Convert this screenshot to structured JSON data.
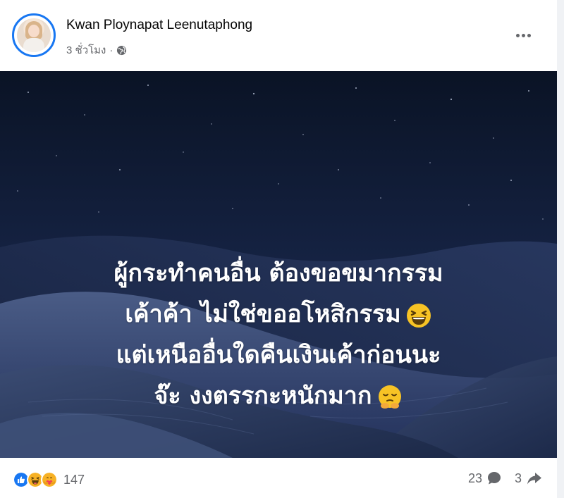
{
  "post": {
    "author": "Kwan Ploynapat Leenutaphong",
    "time": "3 ชั่วโมง",
    "audience_icon": "globe-icon",
    "more_icon": "more-options-icon",
    "text_lines": [
      "ผู้กระทำคนอื่น ต้องขอขมากรรม",
      "เค้าค้า ไม่ใช่ขออโหสิกรรม",
      "แต่เหนืออื่นใดคืนเงินเค้าก่อนนะ",
      "จ๊ะ งงตรรกะหนักมาก"
    ],
    "text_emojis": [
      "laughing-squint-emoji",
      "pleading-face-emoji"
    ],
    "background": "night sky over sand dunes"
  },
  "footer": {
    "reaction_icons": [
      "like-icon",
      "haha-icon",
      "care-icon"
    ],
    "reaction_count": "147",
    "comment_count": "23",
    "comment_icon": "comment-icon",
    "share_count": "3",
    "share_icon": "share-icon"
  },
  "colors": {
    "accent": "#1877f2",
    "secondary_text": "#65676b",
    "haha_yellow": "#f7b125",
    "image_dark": "#0b1527"
  }
}
